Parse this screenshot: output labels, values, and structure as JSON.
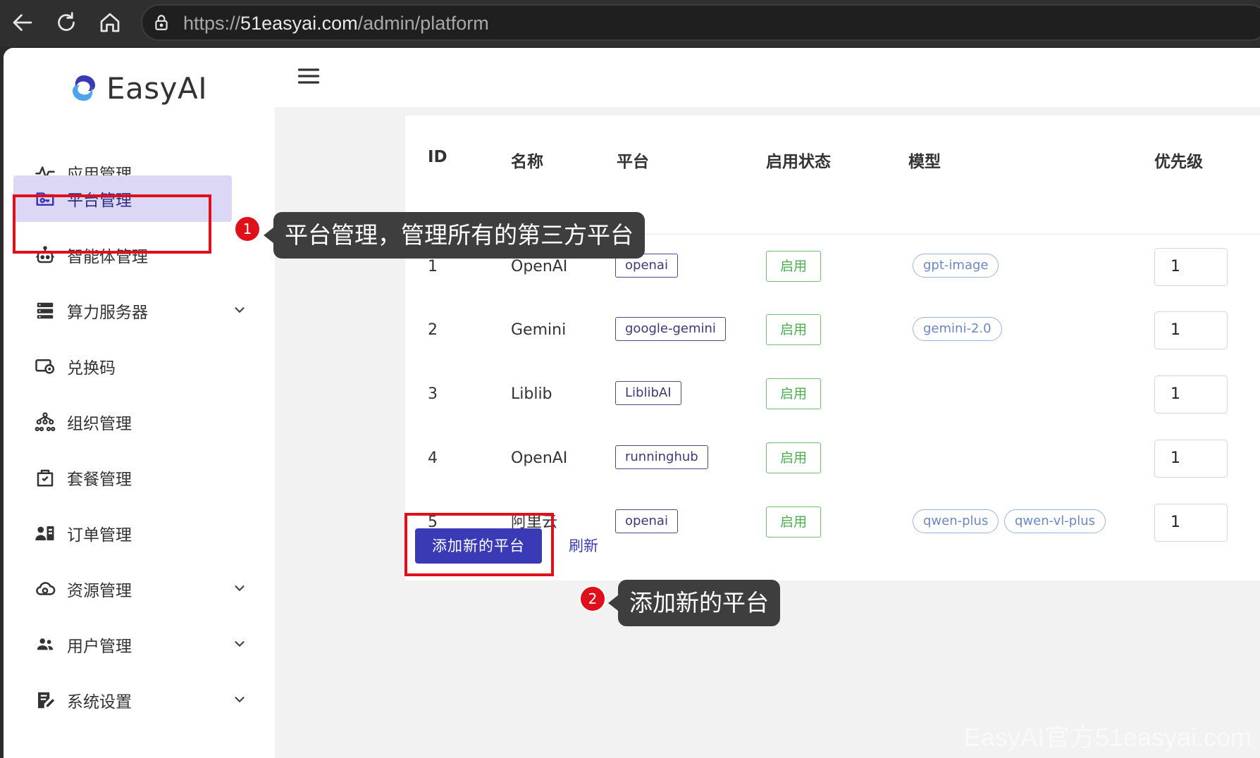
{
  "browser": {
    "url_prefix": "https://",
    "url_domain": "51easyai.com",
    "url_path": "/admin/platform"
  },
  "logo": {
    "text": "EasyAI"
  },
  "sidebar": {
    "items": [
      {
        "label": "应用管理",
        "icon": "app-pulse-icon"
      },
      {
        "label": "平台管理",
        "icon": "folder-key-icon",
        "active": true
      },
      {
        "label": "智能体管理",
        "icon": "robot-icon"
      },
      {
        "label": "算力服务器",
        "icon": "server-icon",
        "expandable": true
      },
      {
        "label": "兑换码",
        "icon": "redeem-card-icon"
      },
      {
        "label": "组织管理",
        "icon": "org-tree-icon"
      },
      {
        "label": "套餐管理",
        "icon": "package-bag-icon"
      },
      {
        "label": "订单管理",
        "icon": "order-icon"
      },
      {
        "label": "资源管理",
        "icon": "cloud-resource-icon",
        "expandable": true
      },
      {
        "label": "用户管理",
        "icon": "users-icon",
        "expandable": true
      },
      {
        "label": "系统设置",
        "icon": "settings-edit-icon",
        "expandable": true
      }
    ]
  },
  "table": {
    "headers": [
      "ID",
      "名称",
      "平台",
      "启用状态",
      "模型",
      "优先级"
    ],
    "rows": [
      {
        "id": "1",
        "name": "OpenAI",
        "platform": "openai",
        "status": "启用",
        "models": [
          "gpt-image"
        ],
        "priority": "1"
      },
      {
        "id": "2",
        "name": "Gemini",
        "platform": "google-gemini",
        "status": "启用",
        "models": [
          "gemini-2.0"
        ],
        "priority": "1"
      },
      {
        "id": "3",
        "name": "Liblib",
        "platform": "LiblibAI",
        "status": "启用",
        "models": [],
        "priority": "1"
      },
      {
        "id": "4",
        "name": "OpenAI",
        "platform": "runninghub",
        "status": "启用",
        "models": [],
        "priority": "1"
      },
      {
        "id": "5",
        "name": "阿里云",
        "platform": "openai",
        "status": "启用",
        "models": [
          "qwen-plus",
          "qwen-vl-plus"
        ],
        "priority": "1"
      }
    ]
  },
  "actions": {
    "add_label": "添加新的平台",
    "refresh_label": "刷新"
  },
  "annotations": [
    {
      "number": "1",
      "text": "平台管理，管理所有的第三方平台"
    },
    {
      "number": "2",
      "text": "添加新的平台"
    }
  ],
  "watermark": "EasyAI官方51easyai.com",
  "colors": {
    "accent": "#3b3ab6",
    "active_bg": "#dcd7f5",
    "annotation_red": "#e0101a",
    "status_green": "#4caf50"
  }
}
